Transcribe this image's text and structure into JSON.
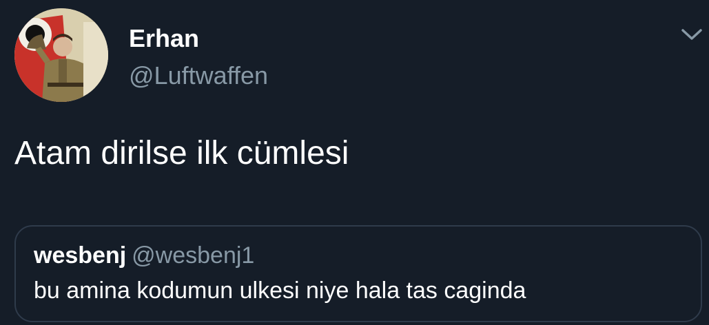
{
  "tweet": {
    "author": {
      "display_name": "Erhan",
      "handle": "@Luftwaffen",
      "avatar_icon": "profile-avatar-image"
    },
    "menu_icon": "chevron-down-icon",
    "text": "Atam dirilse ilk cümlesi",
    "quoted_tweet": {
      "display_name": "wesbenj",
      "handle": "@wesbenj1",
      "text": "bu amina kodumun ulkesi niye hala tas caginda"
    }
  },
  "colors": {
    "background": "#151d28",
    "primary_text": "#ffffff",
    "secondary_text": "#8899a6",
    "border": "#2f3b4b"
  }
}
